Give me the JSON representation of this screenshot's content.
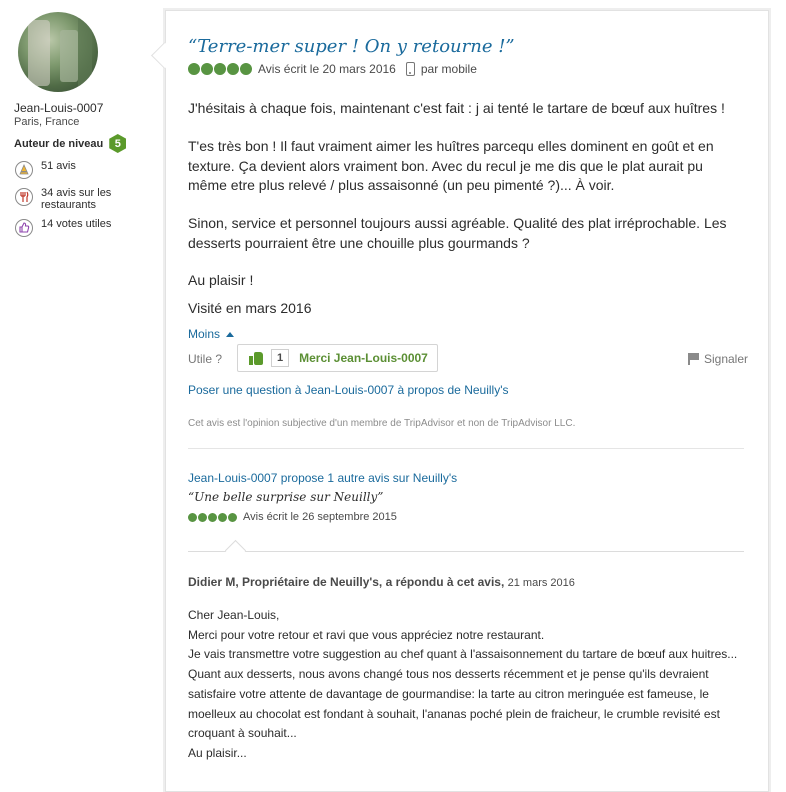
{
  "member": {
    "username": "Jean-Louis-0007",
    "location": "Paris, France",
    "level_label": "Auteur de niveau",
    "level_number": "5",
    "stats": [
      {
        "icon": "pencil-badge-icon",
        "text": "51 avis"
      },
      {
        "icon": "restaurant-fork-icon",
        "text": "34 avis sur les restaurants"
      },
      {
        "icon": "thumbs-up-icon",
        "text": "14 votes utiles"
      }
    ]
  },
  "review": {
    "title": "“Terre-mer super ! On y retourne !”",
    "rating": 5,
    "date_text": "Avis écrit le 20 mars 2016",
    "mobile_text": "par mobile",
    "paragraphs": [
      "J'hésitais à chaque fois, maintenant c'est fait : j ai tenté le tartare de bœuf aux huîtres !",
      "T'es très bon ! Il faut vraiment aimer les huîtres parcequ elles dominent en goût et en texture. Ça devient alors vraiment bon. Avec du recul je me dis que le plat aurait pu même etre plus relevé / plus assaisonné (un peu pimenté ?)... À voir.",
      "Sinon, service et personnel toujours aussi agréable. Qualité des plat irréprochable. Les desserts pourraient être une chouille plus gourmands ?",
      "Au plaisir !",
      "Visité en mars 2016"
    ],
    "less_label": "Moins",
    "helpful_label": "Utile ?",
    "helpful_count": "1",
    "thank_label": "Merci Jean-Louis-0007",
    "report_label": "Signaler",
    "ask_label": "Poser une question à Jean-Louis-0007 à propos de Neuilly's",
    "disclaimer": "Cet avis est l'opinion subjective d'un membre de TripAdvisor et non de TripAdvisor LLC."
  },
  "other_review": {
    "link": "Jean-Louis-0007 propose 1 autre avis sur Neuilly's",
    "title": "“Une belle surprise sur Neuilly”",
    "rating": 5,
    "date_text": "Avis écrit le 26 septembre 2015"
  },
  "response": {
    "header": "Didier M, Propriétaire de Neuilly's, a répondu à cet avis,",
    "date": "21 mars 2016",
    "lines": [
      "Cher Jean-Louis,",
      "Merci pour votre retour et ravi que vous appréciez notre restaurant.",
      "Je vais transmettre votre suggestion au chef quant à l'assaisonnement du tartare de bœuf aux huitres...",
      "Quant aux desserts, nous avons changé tous nos desserts récemment et je pense qu'ils devraient",
      "satisfaire votre attente de davantage de gourmandise: la tarte au citron meringuée est fameuse, le",
      "moelleux au chocolat est fondant à souhait, l'ananas poché plein de fraicheur, le crumble revisité est",
      "croquant à souhait...",
      "Au plaisir..."
    ]
  },
  "colors": {
    "link_blue": "#1a6a9c",
    "rating_green": "#589442",
    "level_badge_green": "#5b9a2b"
  }
}
